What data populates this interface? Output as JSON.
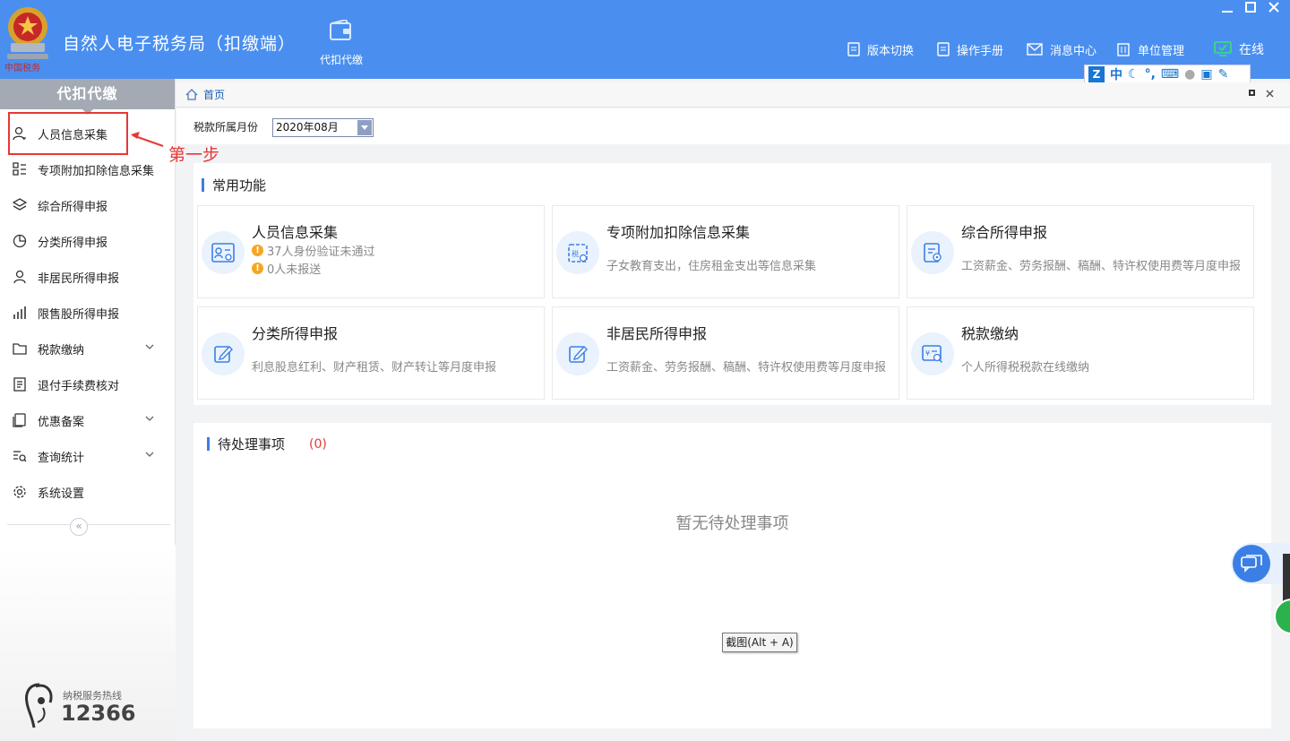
{
  "app": {
    "title": "自然人电子税务局（扣缴端）",
    "module": "代扣代缴"
  },
  "header_links": [
    {
      "label": "版本切换"
    },
    {
      "label": "操作手册"
    },
    {
      "label": "消息中心"
    },
    {
      "label": "单位管理"
    },
    {
      "label": "在线"
    }
  ],
  "ime": {
    "mode": "中"
  },
  "sidebar": {
    "title": "代扣代缴",
    "items": [
      {
        "label": "人员信息采集"
      },
      {
        "label": "专项附加扣除信息采集"
      },
      {
        "label": "综合所得申报"
      },
      {
        "label": "分类所得申报"
      },
      {
        "label": "非居民所得申报"
      },
      {
        "label": "限售股所得申报"
      },
      {
        "label": "税款缴纳"
      },
      {
        "label": "退付手续费核对"
      },
      {
        "label": "优惠备案"
      },
      {
        "label": "查询统计"
      },
      {
        "label": "系统设置"
      }
    ],
    "hotline_label": "纳税服务热线",
    "hotline_number": "12366"
  },
  "annotation": {
    "step_label": "第一步"
  },
  "breadcrumb": {
    "home": "首页"
  },
  "filter": {
    "month_label": "税款所属月份",
    "month_value": "2020年08月"
  },
  "common": {
    "title": "常用功能",
    "cards": [
      {
        "title": "人员信息采集",
        "warn1": "37人身份验证未通过",
        "warn2": "0人未报送"
      },
      {
        "title": "专项附加扣除信息采集",
        "desc": "子女教育支出，住房租金支出等信息采集"
      },
      {
        "title": "综合所得申报",
        "desc": "工资薪金、劳务报酬、稿酬、特许权使用费等月度申报"
      },
      {
        "title": "分类所得申报",
        "desc": "利息股息红利、财产租赁、财产转让等月度申报"
      },
      {
        "title": "非居民所得申报",
        "desc": "工资薪金、劳务报酬、稿酬、特许权使用费等月度申报"
      },
      {
        "title": "税款缴纳",
        "desc": "个人所得税税款在线缴纳"
      }
    ]
  },
  "pending": {
    "title": "待处理事项",
    "count": "(0)",
    "empty": "暂无待处理事项"
  },
  "tooltip": "截图(Alt + A)"
}
